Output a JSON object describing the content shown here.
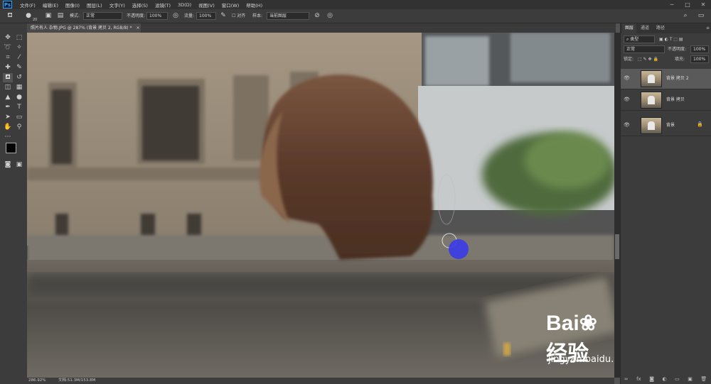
{
  "app": {
    "logo": "Ps"
  },
  "menu": [
    "文件(F)",
    "编辑(E)",
    "图像(I)",
    "图层(L)",
    "文字(Y)",
    "选择(S)",
    "滤镜(T)",
    "3D(D)",
    "视图(V)",
    "窗口(W)",
    "帮助(H)"
  ],
  "window_controls": {
    "minimize": "─",
    "maximize": "□",
    "close": "✕"
  },
  "options": {
    "brush_size": "20",
    "mode_label": "模式:",
    "mode_value": "正常",
    "opacity_label": "不透明度:",
    "opacity_value": "100%",
    "flow_label": "流量:",
    "flow_value": "100%",
    "aligned_label": "对齐",
    "sample_label": "样本:",
    "sample_value": "当前图层"
  },
  "document": {
    "tab_title": "照片有人 杂物.JPG @ 287% (背景 拷贝 2, RGB/8) *",
    "close": "×"
  },
  "status": {
    "zoom": "286.92%",
    "doc_info": "文档:51.3M/153.8M"
  },
  "panel": {
    "tabs": [
      "图层",
      "通道",
      "路径"
    ],
    "filter_kind": "类型",
    "blend_mode": "正常",
    "opacity_label": "不透明度:",
    "opacity_value": "100%",
    "lock_label": "锁定:",
    "fill_label": "填充:",
    "fill_value": "100%",
    "layers": [
      {
        "name": "背景 拷贝 2",
        "selected": true,
        "locked": false
      },
      {
        "name": "背景 拷贝",
        "selected": false,
        "locked": false
      },
      {
        "name": "背景",
        "selected": false,
        "locked": true
      }
    ]
  },
  "watermark": {
    "brand": "Bai",
    "brand2": "经验",
    "url": "jingyan.baidu.com"
  },
  "colors": {
    "brush_cursor": "#3a3ae8",
    "menubar": "#323232",
    "panel": "#3c3c3c"
  }
}
